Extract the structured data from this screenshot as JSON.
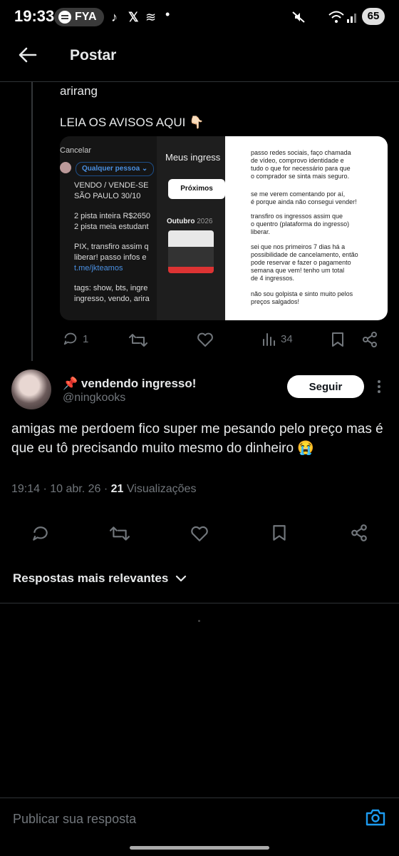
{
  "status_bar": {
    "time": "19:33",
    "spotify_label": "FYA",
    "battery": "65"
  },
  "header": {
    "title": "Postar"
  },
  "parent_post": {
    "text_line1": "arirang",
    "text_line2": "LEIA OS AVISOS AQUI 👇🏻",
    "media": {
      "left_panel": {
        "cancel": "Cancelar",
        "audience": "Qualquer pessoa",
        "lines": [
          "VENDO / VENDE-SE",
          "SÃO PAULO 30/10",
          "",
          "2 pista inteira R$2650",
          "2 pista meia estudant",
          "",
          "PIX, transfiro assim q",
          "liberar! passo infos e",
          "t.me/jkteamos",
          "",
          "tags: show, bts, ingre",
          "ingresso, vendo, arira"
        ]
      },
      "middle_panel": {
        "title": "Meus ingress",
        "button": "Próximos",
        "month": "Outubro",
        "year": "2026"
      },
      "right_panel": {
        "paragraphs": [
          "passo redes sociais, faço chamada\nde vídeo, comprovo identidade e\ntudo o que for necessário para que\no comprador se sinta mais seguro.",
          "se me verem comentando por aí,\né porque ainda não consegui vender!",
          "transfiro os ingressos assim que\no quentro (plataforma do ingresso)\nliberar.",
          "sei que nos primeiros 7 dias há a\npossibilidade de cancelamento, então\npode reservar e fazer o pagamento\nsemana que vem! tenho um total\nde 4 ingressos.",
          "não sou golpista e sinto muito pelos\npreços salgados!"
        ]
      }
    },
    "actions": {
      "replies": "1",
      "views": "34"
    }
  },
  "reply": {
    "author_name": "📌 vendendo ingresso!",
    "handle": "@ningkooks",
    "follow_label": "Seguir",
    "text": "amigas me perdoem fico super me pesando pelo preço mas é que eu tô precisando muito mesmo do dinheiro 😭",
    "time": "19:14",
    "date": "10 abr. 26",
    "views_count": "21",
    "views_label": "Visualizações"
  },
  "sort": {
    "label": "Respostas mais relevantes"
  },
  "compose": {
    "placeholder": "Publicar sua resposta"
  },
  "colors": {
    "background": "#000000",
    "text": "#e7e9ea",
    "muted": "#71767b",
    "link": "#1d9bf0"
  }
}
